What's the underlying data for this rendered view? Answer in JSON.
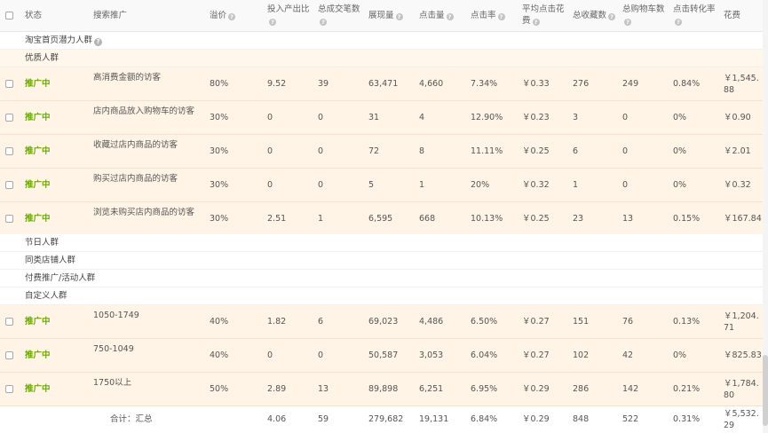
{
  "header": {
    "status": "状态",
    "promo": "搜索推广",
    "premium": "溢价",
    "roi": "投入产出比",
    "deals": "总成交笔数",
    "impressions": "展现量",
    "clicks": "点击量",
    "ctr": "点击率",
    "avg_cost_l1": "平均点击花",
    "avg_cost_l2": "费",
    "favorites": "总收藏数",
    "cart_l1": "总购物车数",
    "conversion": "点击转化率",
    "cost": "花费"
  },
  "groups": {
    "top": "淘宝首页潜力人群",
    "quality": "优质人群",
    "holiday": "节日人群",
    "similar": "同类店铺人群",
    "paid": "付费推广/活动人群",
    "custom": "自定义人群"
  },
  "quality_rows": [
    {
      "status": "推广中",
      "name": "高消费金额的访客",
      "premium": "80%",
      "roi": "9.52",
      "deals": "39",
      "impressions": "63,471",
      "clicks": "4,660",
      "ctr": "7.34%",
      "avg_cost": "￥0.33",
      "favorites": "276",
      "cart": "249",
      "conversion": "0.84%",
      "cost": "￥1,545.88"
    },
    {
      "status": "推广中",
      "name": "店内商品放入购物车的访客",
      "premium": "30%",
      "roi": "0",
      "deals": "0",
      "impressions": "31",
      "clicks": "4",
      "ctr": "12.90%",
      "avg_cost": "￥0.23",
      "favorites": "3",
      "cart": "0",
      "conversion": "0%",
      "cost": "￥0.90"
    },
    {
      "status": "推广中",
      "name": "收藏过店内商品的访客",
      "premium": "30%",
      "roi": "0",
      "deals": "0",
      "impressions": "72",
      "clicks": "8",
      "ctr": "11.11%",
      "avg_cost": "￥0.25",
      "favorites": "6",
      "cart": "0",
      "conversion": "0%",
      "cost": "￥2.01"
    },
    {
      "status": "推广中",
      "name": "购买过店内商品的访客",
      "premium": "30%",
      "roi": "0",
      "deals": "0",
      "impressions": "5",
      "clicks": "1",
      "ctr": "20%",
      "avg_cost": "￥0.32",
      "favorites": "1",
      "cart": "0",
      "conversion": "0%",
      "cost": "￥0.32"
    },
    {
      "status": "推广中",
      "name": "浏览未购买店内商品的访客",
      "premium": "30%",
      "roi": "2.51",
      "deals": "1",
      "impressions": "6,595",
      "clicks": "668",
      "ctr": "10.13%",
      "avg_cost": "￥0.25",
      "favorites": "23",
      "cart": "13",
      "conversion": "0.15%",
      "cost": "￥167.84"
    }
  ],
  "custom_rows": [
    {
      "status": "推广中",
      "name": "1050-1749",
      "premium": "40%",
      "roi": "1.82",
      "deals": "6",
      "impressions": "69,023",
      "clicks": "4,486",
      "ctr": "6.50%",
      "avg_cost": "￥0.27",
      "favorites": "151",
      "cart": "76",
      "conversion": "0.13%",
      "cost": "￥1,204.71"
    },
    {
      "status": "推广中",
      "name": "750-1049",
      "premium": "40%",
      "roi": "0",
      "deals": "0",
      "impressions": "50,587",
      "clicks": "3,053",
      "ctr": "6.04%",
      "avg_cost": "￥0.27",
      "favorites": "102",
      "cart": "42",
      "conversion": "0%",
      "cost": "￥825.83"
    },
    {
      "status": "推广中",
      "name": "1750以上",
      "premium": "50%",
      "roi": "2.89",
      "deals": "13",
      "impressions": "89,898",
      "clicks": "6,251",
      "ctr": "6.95%",
      "avg_cost": "￥0.29",
      "favorites": "286",
      "cart": "142",
      "conversion": "0.21%",
      "cost": "￥1,784.80"
    }
  ],
  "total": {
    "label": "合计：汇总",
    "roi": "4.06",
    "deals": "59",
    "impressions": "279,682",
    "clicks": "19,131",
    "ctr": "6.84%",
    "avg_cost": "￥0.29",
    "favorites": "848",
    "cart": "522",
    "conversion": "0.31%",
    "cost": "￥5,532.29"
  },
  "icons": {
    "help": "question-circle-icon",
    "checkbox": "checkbox-icon"
  },
  "colors": {
    "status_active": "#6aa80e",
    "row_highlight": "#fff4e6"
  }
}
